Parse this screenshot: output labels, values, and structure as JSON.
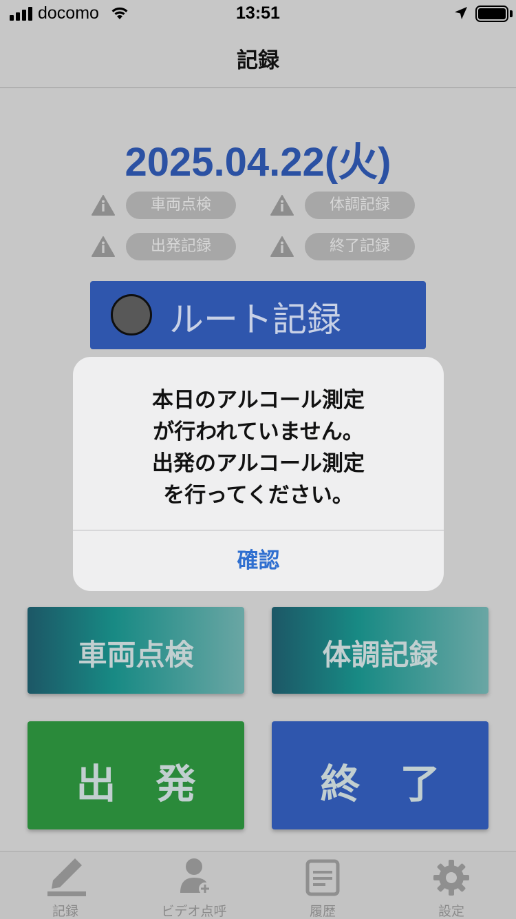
{
  "status_bar": {
    "carrier": "docomo",
    "time": "13:51"
  },
  "nav": {
    "title": "記録"
  },
  "date": "2025.04.22(火)",
  "statuses": [
    "車両点検",
    "体調記録",
    "出発記録",
    "終了記録"
  ],
  "route_button": {
    "label": "ルート記録"
  },
  "buttons": {
    "vehicle_check": "車両点検",
    "health_record": "体調記録",
    "depart": "出　発",
    "finish": "終　了"
  },
  "alert": {
    "lines": [
      "本日のアルコール測定",
      "が行われていません。",
      "出発のアルコール測定",
      "を行ってください。"
    ],
    "confirm": "確認"
  },
  "tabs": [
    {
      "label": "記録",
      "icon": "pencil-icon"
    },
    {
      "label": "ビデオ点呼",
      "icon": "person-video-icon"
    },
    {
      "label": "履歴",
      "icon": "history-icon"
    },
    {
      "label": "設定",
      "icon": "gear-icon"
    }
  ],
  "colors": {
    "accent_blue": "#2f56ad",
    "depart_green": "#2a8a3a",
    "date_blue": "#2b51a3",
    "alert_button": "#2f6fd0"
  }
}
